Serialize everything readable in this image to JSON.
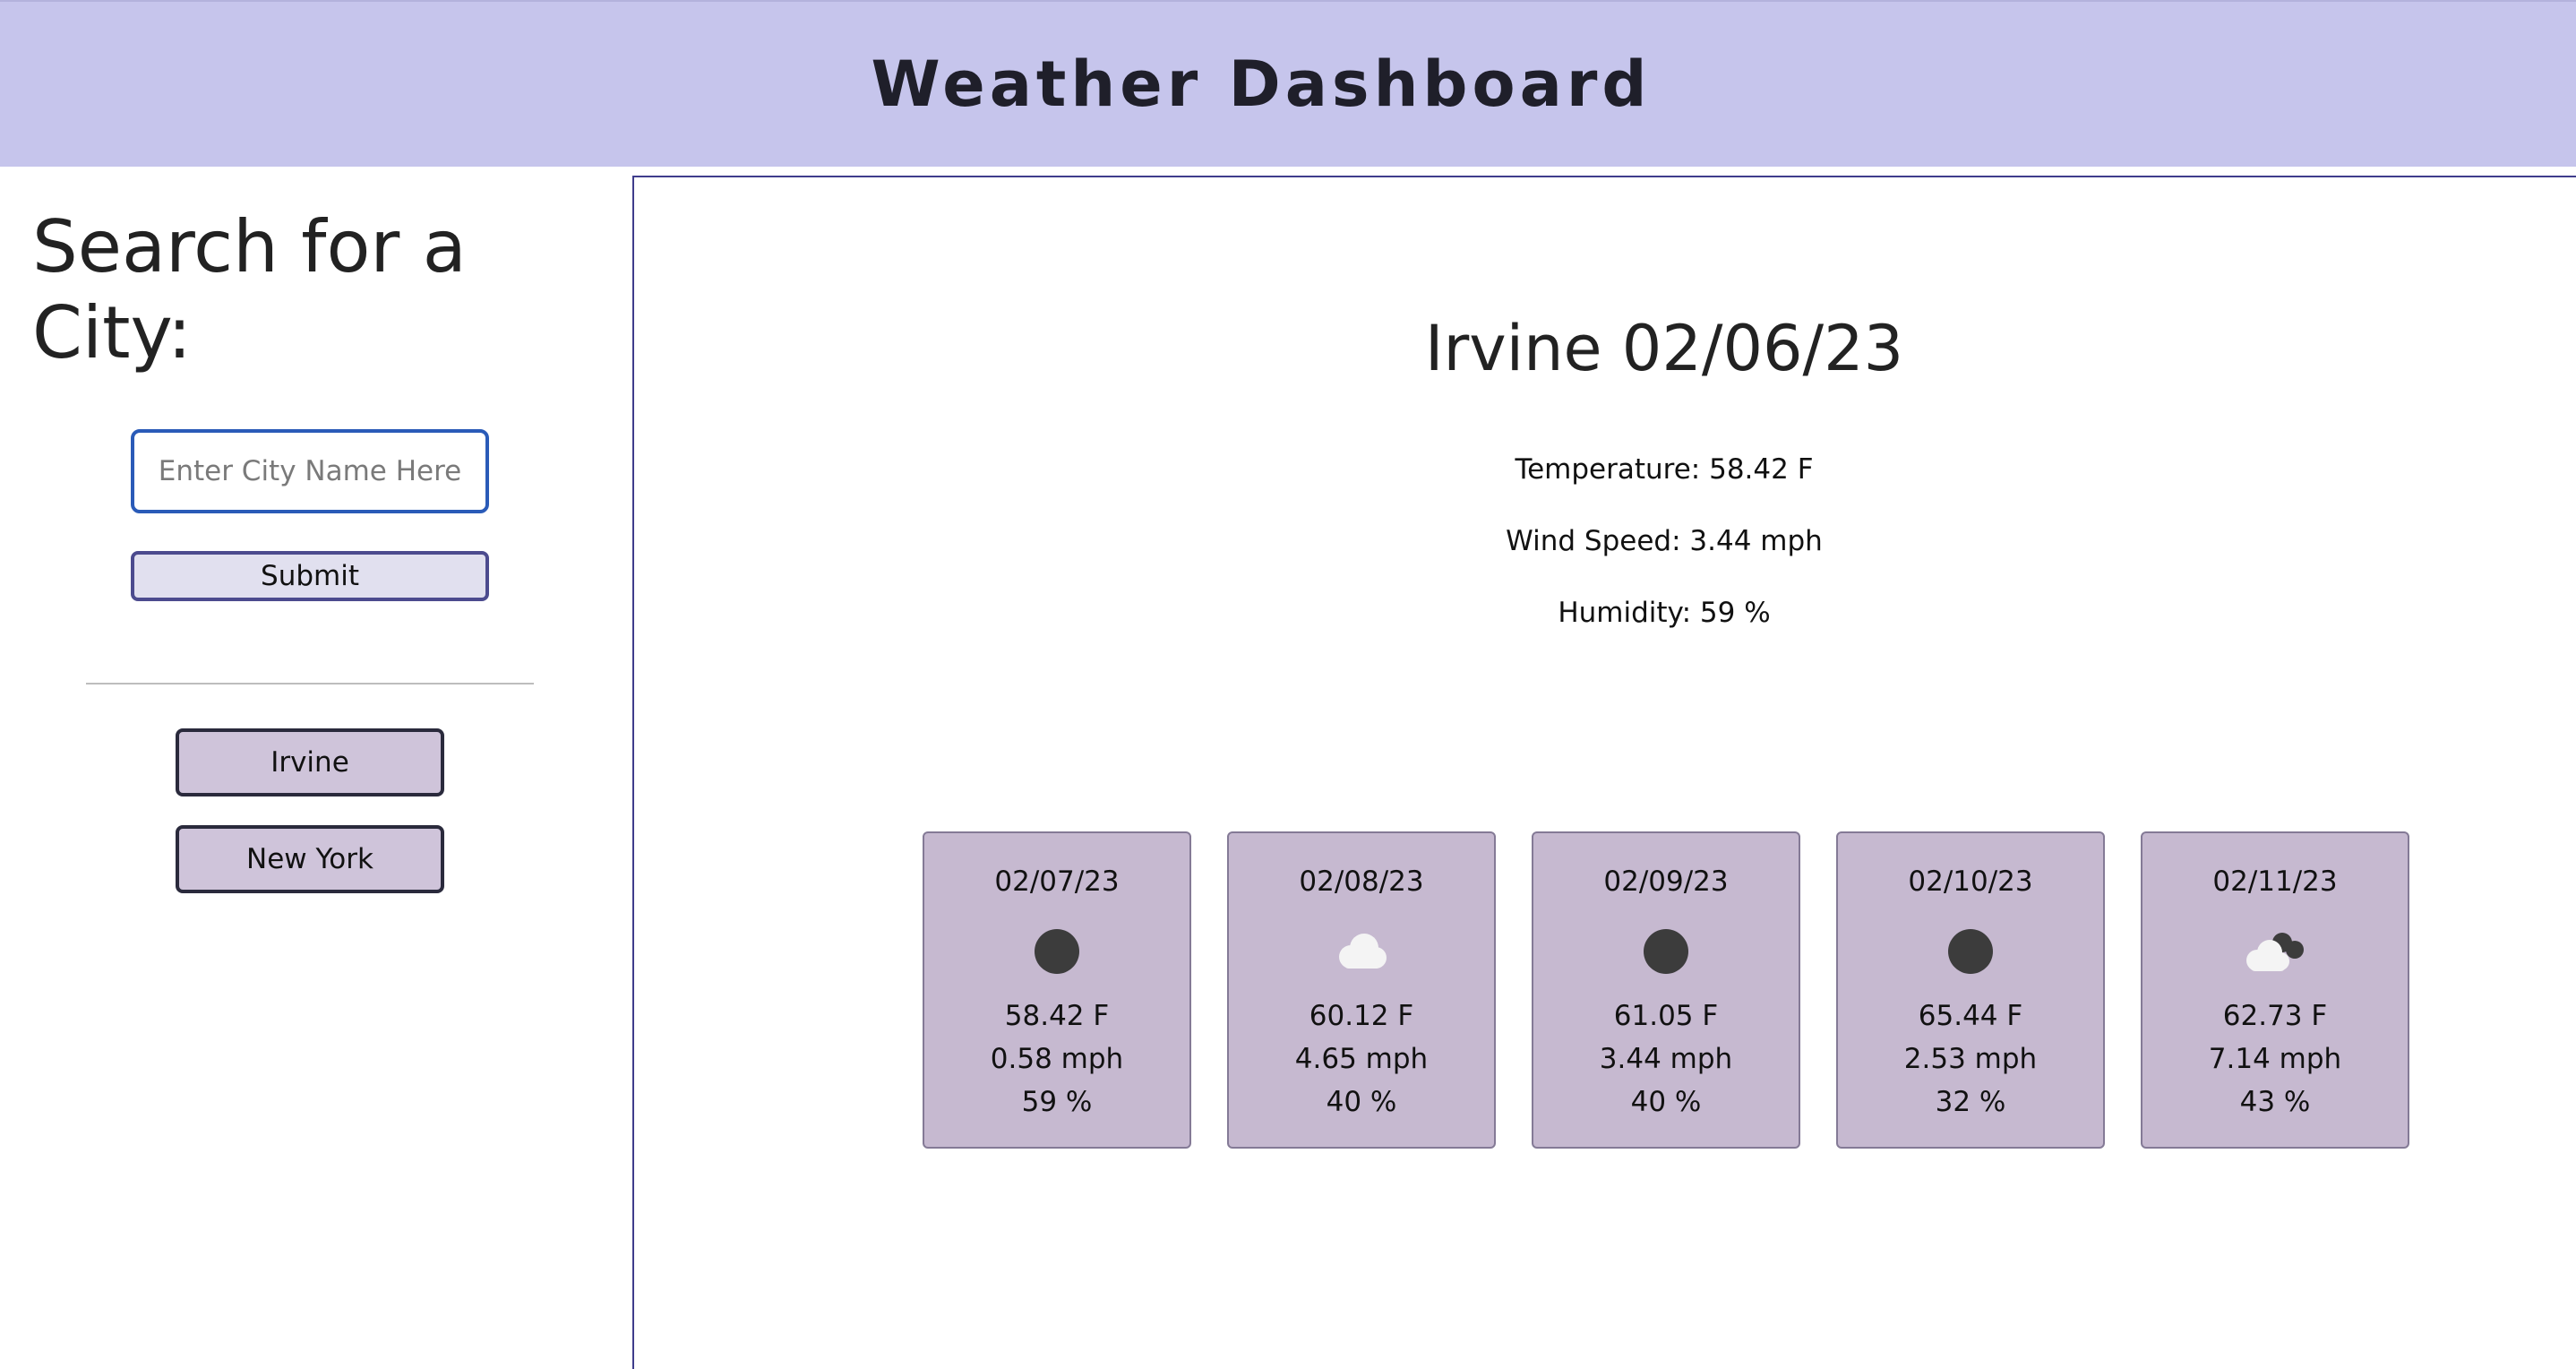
{
  "header": {
    "title": "Weather Dashboard"
  },
  "sidebar": {
    "heading": "Search for a City:",
    "search_placeholder": "Enter City Name Here",
    "submit_label": "Submit",
    "history": [
      "Irvine",
      "New York"
    ]
  },
  "current": {
    "title": "Irvine 02/06/23",
    "temperature": "Temperature: 58.42 F",
    "wind": "Wind Speed: 3.44 mph",
    "humidity": "Humidity: 59 %"
  },
  "forecast": [
    {
      "date": "02/07/23",
      "icon": "moon-icon",
      "temp": "58.42 F",
      "wind": "0.58 mph",
      "humidity": "59 %"
    },
    {
      "date": "02/08/23",
      "icon": "cloud-icon",
      "temp": "60.12 F",
      "wind": "4.65 mph",
      "humidity": "40 %"
    },
    {
      "date": "02/09/23",
      "icon": "moon-icon",
      "temp": "61.05 F",
      "wind": "3.44 mph",
      "humidity": "40 %"
    },
    {
      "date": "02/10/23",
      "icon": "moon-icon",
      "temp": "65.44 F",
      "wind": "2.53 mph",
      "humidity": "32 %"
    },
    {
      "date": "02/11/23",
      "icon": "broken-clouds-icon",
      "temp": "62.73 F",
      "wind": "7.14 mph",
      "humidity": "43 %"
    }
  ],
  "colors": {
    "header_bg": "#c6c5ec",
    "card_bg": "#c6b9d0",
    "history_btn_bg": "#cfc4da",
    "submit_bg": "#e1e0ef",
    "main_border": "#3f3d8c",
    "input_border": "#2a5bb8"
  }
}
